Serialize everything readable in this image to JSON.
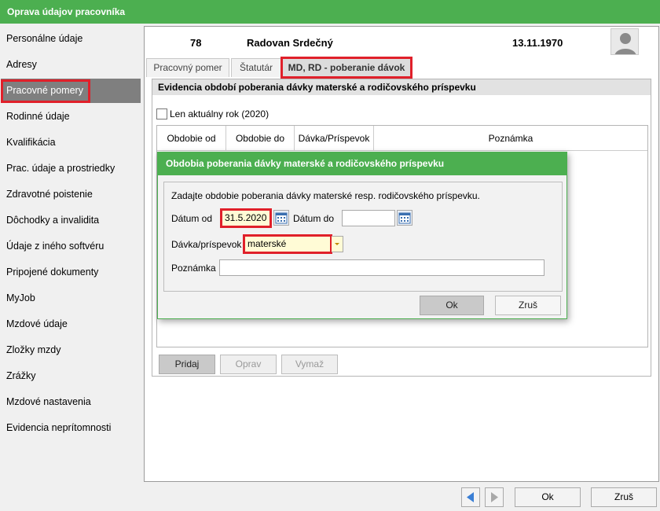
{
  "window": {
    "title": "Oprava údajov pracovníka"
  },
  "sidebar": {
    "items": [
      {
        "label": "Personálne údaje"
      },
      {
        "label": "Adresy"
      },
      {
        "label": "Pracovné pomery"
      },
      {
        "label": "Rodinné údaje"
      },
      {
        "label": "Kvalifikácia"
      },
      {
        "label": "Prac. údaje a prostriedky"
      },
      {
        "label": "Zdravotné poistenie"
      },
      {
        "label": "Dôchodky a invalidita"
      },
      {
        "label": "Údaje z iného softvéru"
      },
      {
        "label": "Pripojené dokumenty"
      },
      {
        "label": "MyJob"
      },
      {
        "label": "Mzdové údaje"
      },
      {
        "label": "Zložky mzdy"
      },
      {
        "label": "Zrážky"
      },
      {
        "label": "Mzdové nastavenia"
      },
      {
        "label": "Evidencia neprítomnosti"
      }
    ],
    "active_index": 2
  },
  "employee": {
    "id": "78",
    "name": "Radovan Srdečný",
    "birth_date": "13.11.1970"
  },
  "tabs": [
    {
      "label": "Pracovný pomer"
    },
    {
      "label": "Štatutár"
    },
    {
      "label": "MD, RD - poberanie dávok"
    }
  ],
  "panel": {
    "title": "Evidencia období poberania dávky materské a rodičovského príspevku",
    "checkbox_label": "Len aktuálny rok (2020)",
    "columns": [
      "Obdobie od",
      "Obdobie do",
      "Dávka/Príspevok",
      "Poznámka"
    ],
    "buttons": {
      "add": "Pridaj",
      "edit": "Oprav",
      "delete": "Vymaž"
    }
  },
  "dialog": {
    "title": "Obdobia poberania dávky materské a rodičovského príspevku",
    "instruction": "Zadajte obdobie poberania dávky materské resp. rodičovského príspevku.",
    "date_from_label": "Dátum od",
    "date_from_value": "31.5.2020",
    "date_to_label": "Dátum do",
    "date_to_value": "",
    "benefit_label": "Dávka/príspevok",
    "benefit_value": "materské",
    "note_label": "Poznámka",
    "note_value": "",
    "ok_label": "Ok",
    "cancel_label": "Zruš"
  },
  "footer": {
    "ok_label": "Ok",
    "cancel_label": "Zruš"
  },
  "colors": {
    "accent": "#4caf50",
    "highlight": "#e0202a",
    "field_highlight": "#fffbd6"
  }
}
